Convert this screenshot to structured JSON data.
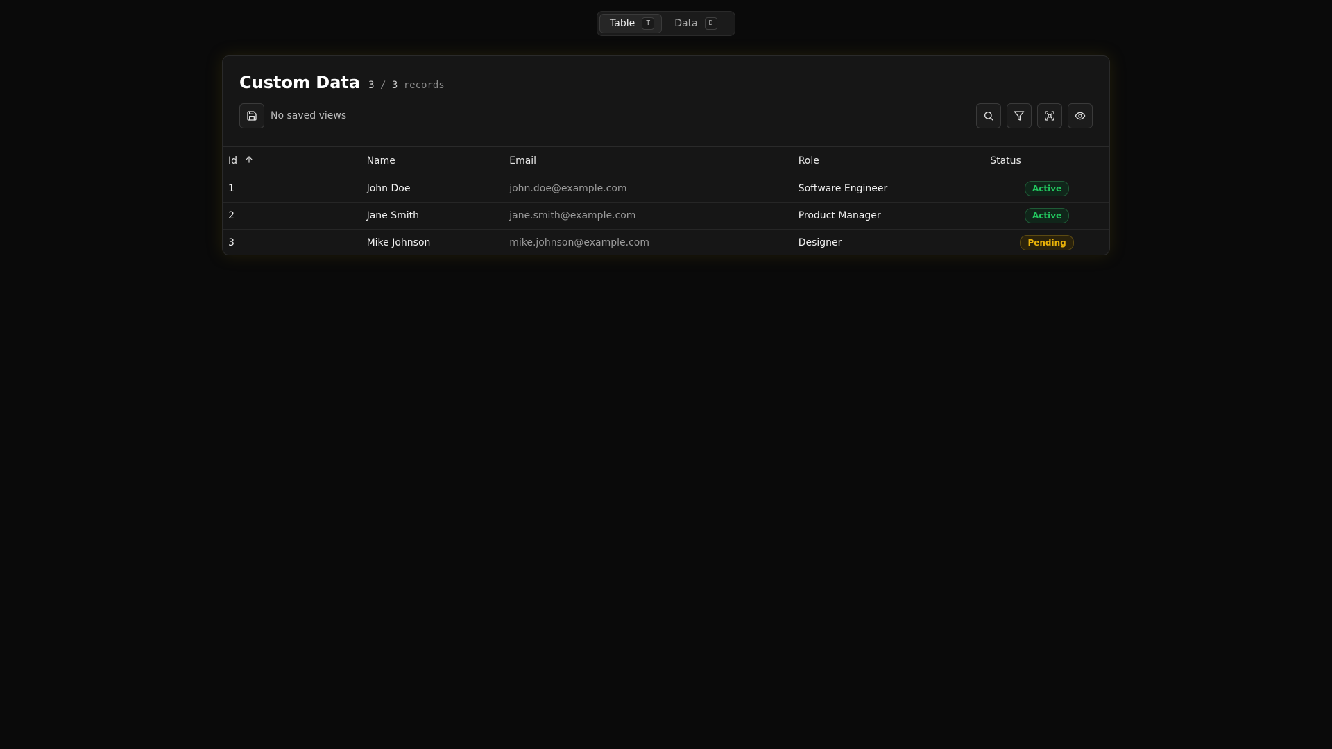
{
  "switcher": {
    "tabs": [
      {
        "label": "Table",
        "key": "T",
        "active": true
      },
      {
        "label": "Data",
        "key": "D",
        "active": false
      }
    ]
  },
  "card": {
    "title": "Custom Data",
    "count_shown": "3",
    "count_sep": "/",
    "count_total": "3",
    "count_unit": "records",
    "views_label": "No saved views"
  },
  "icons": {
    "save": "save-icon",
    "search": "search-icon",
    "filter": "filter-icon",
    "scan": "scan-icon",
    "eye": "eye-icon",
    "sort": "arrow-up-icon"
  },
  "table": {
    "columns": [
      "Id",
      "Name",
      "Email",
      "Role",
      "Status"
    ],
    "rows": [
      {
        "id": "1",
        "name": "John Doe",
        "email": "john.doe@example.com",
        "role": "Software Engineer",
        "status": "Active"
      },
      {
        "id": "2",
        "name": "Jane Smith",
        "email": "jane.smith@example.com",
        "role": "Product Manager",
        "status": "Active"
      },
      {
        "id": "3",
        "name": "Mike Johnson",
        "email": "mike.johnson@example.com",
        "role": "Designer",
        "status": "Pending"
      }
    ]
  },
  "colors": {
    "active": "#22c55e",
    "pending": "#eab308",
    "background": "#0a0a0a"
  }
}
